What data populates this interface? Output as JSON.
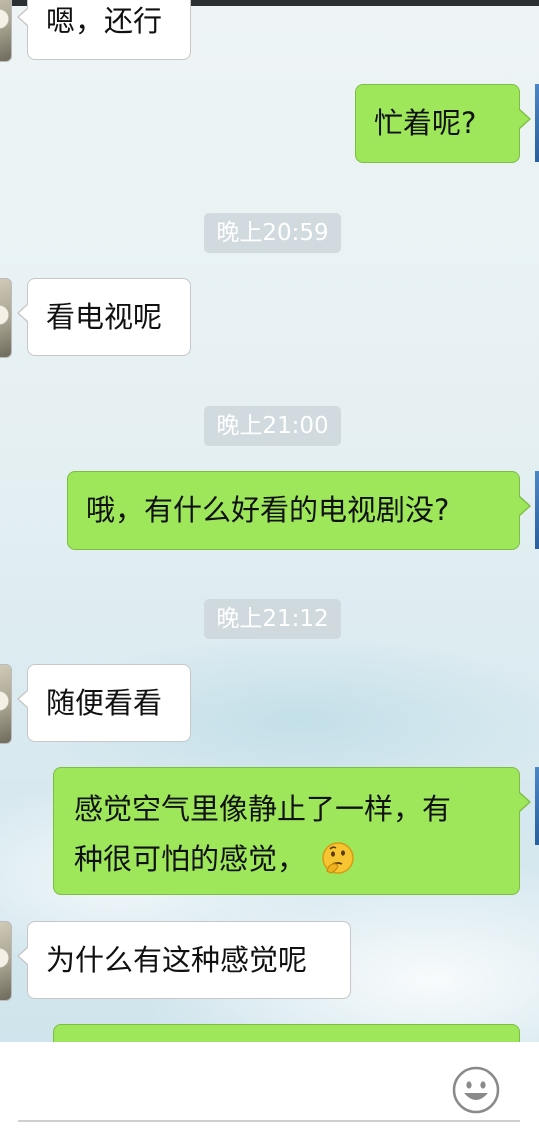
{
  "messages": [
    {
      "side": "in",
      "text": "嗯，还行"
    },
    {
      "side": "out",
      "text": "忙着呢?"
    },
    {
      "type": "time",
      "text": "晚上20:59"
    },
    {
      "side": "in",
      "text": "看电视呢"
    },
    {
      "type": "time",
      "text": "晚上21:00"
    },
    {
      "side": "out",
      "text": "哦，有什么好看的电视剧没?"
    },
    {
      "type": "time",
      "text": "晚上21:12"
    },
    {
      "side": "in",
      "text": "随便看看"
    },
    {
      "side": "out",
      "line1": "感觉空气里像静止了一样，有",
      "line2": "种很可怕的感觉，",
      "emoji": "thinking-face-emoji"
    },
    {
      "side": "in",
      "text": "为什么有这种感觉呢"
    }
  ],
  "input": {
    "value": "",
    "emoji_button_icon": "smiley-face-icon"
  },
  "colors": {
    "outgoing_bubble": "#9ee65a",
    "incoming_bubble": "#ffffff",
    "timestamp_bg": "#cdd6da"
  }
}
